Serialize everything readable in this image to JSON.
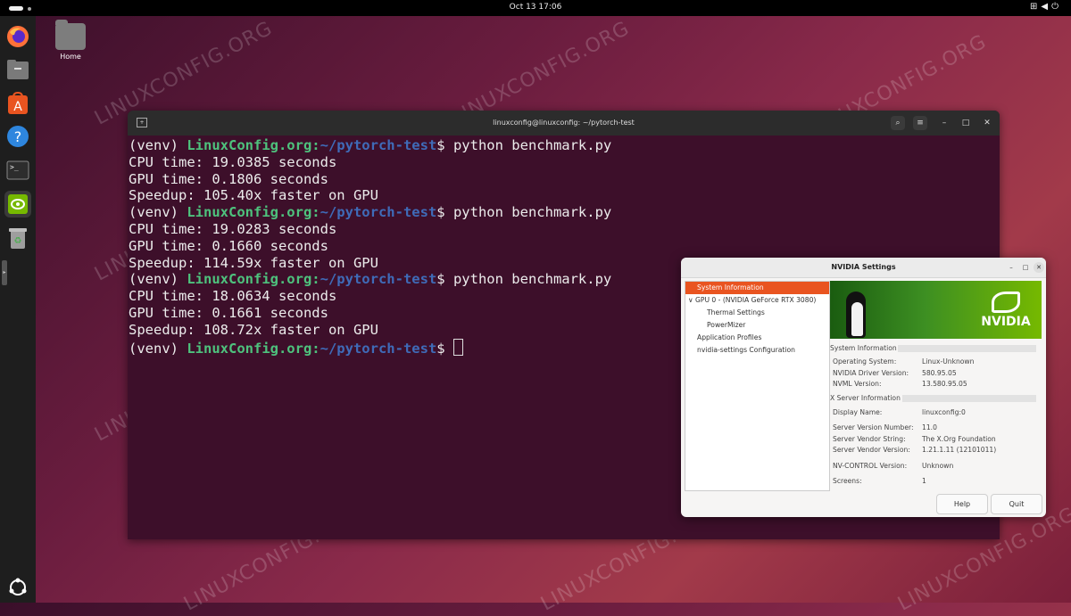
{
  "topbar": {
    "clock": "Oct 13  17:06",
    "tray_icons": [
      "network-icon",
      "volume-icon",
      "power-icon"
    ]
  },
  "desktop": {
    "home_label": "Home"
  },
  "dock": {
    "items": [
      "firefox-icon",
      "files-icon",
      "app-center-icon",
      "help-icon",
      "terminal-icon",
      "nvidia-settings-icon",
      "trash-icon",
      "show-apps-icon"
    ]
  },
  "watermark": "LINUXCONFIG.ORG",
  "terminal": {
    "title": "linuxconfig@linuxconfig: ~/pytorch-test",
    "lines": [
      {
        "venv": "(venv) ",
        "host": "LinuxConfig.org:",
        "path": "~/pytorch-test",
        "cmd": "$ python benchmark.py"
      },
      {
        "text": "CPU time: 19.0385 seconds"
      },
      {
        "text": "GPU time: 0.1806 seconds"
      },
      {
        "text": "Speedup: 105.40x faster on GPU"
      },
      {
        "venv": "(venv) ",
        "host": "LinuxConfig.org:",
        "path": "~/pytorch-test",
        "cmd": "$ python benchmark.py"
      },
      {
        "text": "CPU time: 19.0283 seconds"
      },
      {
        "text": "GPU time: 0.1660 seconds"
      },
      {
        "text": "Speedup: 114.59x faster on GPU"
      },
      {
        "venv": "(venv) ",
        "host": "LinuxConfig.org:",
        "path": "~/pytorch-test",
        "cmd": "$ python benchmark.py"
      },
      {
        "text": "CPU time: 18.0634 seconds"
      },
      {
        "text": "GPU time: 0.1661 seconds"
      },
      {
        "text": "Speedup: 108.72x faster on GPU"
      },
      {
        "venv": "(venv) ",
        "host": "LinuxConfig.org:",
        "path": "~/pytorch-test",
        "cmd": "$ "
      }
    ]
  },
  "nvidia": {
    "title": "NVIDIA Settings",
    "tree": [
      {
        "label": "System Information",
        "indent": 1,
        "selected": true
      },
      {
        "label": "GPU 0 - (NVIDIA GeForce RTX 3080)",
        "indent": 0,
        "expander": "∨"
      },
      {
        "label": "Thermal Settings",
        "indent": 2
      },
      {
        "label": "PowerMizer",
        "indent": 2
      },
      {
        "label": "Application Profiles",
        "indent": 1
      },
      {
        "label": "nvidia-settings Configuration",
        "indent": 1
      }
    ],
    "banner_logo": "NVIDIA",
    "system_section": "System Information",
    "system_rows": [
      {
        "k": "Operating System:",
        "v": "Linux-Unknown"
      },
      {
        "k": "NVIDIA Driver Version:",
        "v": "580.95.05"
      },
      {
        "k": "NVML Version:",
        "v": "13.580.95.05"
      }
    ],
    "x_section": "X Server Information",
    "x_rows": [
      {
        "k": "Display Name:",
        "v": "linuxconfig:0",
        "gap": 0
      },
      {
        "k": "Server Version Number:",
        "v": "11.0",
        "gap": 1
      },
      {
        "k": "Server Vendor String:",
        "v": "The X.Org Foundation",
        "gap": 0
      },
      {
        "k": "Server Vendor Version:",
        "v": "1.21.1.11 (12101011)",
        "gap": 0
      },
      {
        "k": "NV-CONTROL Version:",
        "v": "Unknown",
        "gap": 1
      },
      {
        "k": "Screens:",
        "v": "1",
        "gap": 1
      }
    ],
    "buttons": {
      "help": "Help",
      "quit": "Quit"
    }
  }
}
